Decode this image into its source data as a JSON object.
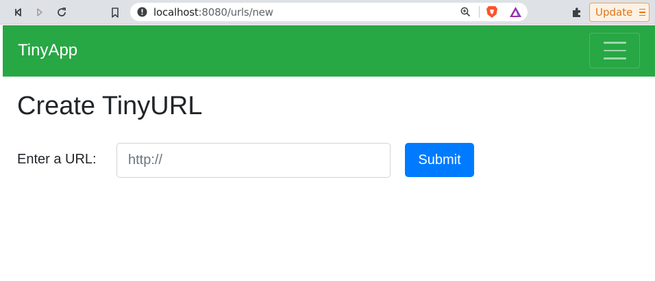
{
  "browser": {
    "url_host": "localhost",
    "url_rest": ":8080/urls/new",
    "update_label": "Update"
  },
  "navbar": {
    "brand": "TinyApp",
    "color": "#28a745"
  },
  "main": {
    "title": "Create TinyURL",
    "url_label": "Enter a URL:",
    "url_placeholder": "http://",
    "submit_label": "Submit",
    "submit_color": "#007bff"
  },
  "icons": [
    "back-icon",
    "forward-icon",
    "reload-icon",
    "bookmark-icon",
    "info-icon",
    "zoom-icon",
    "brave-shield-icon",
    "brave-rewards-icon",
    "extensions-icon",
    "menu-icon",
    "navbar-toggler-icon"
  ]
}
